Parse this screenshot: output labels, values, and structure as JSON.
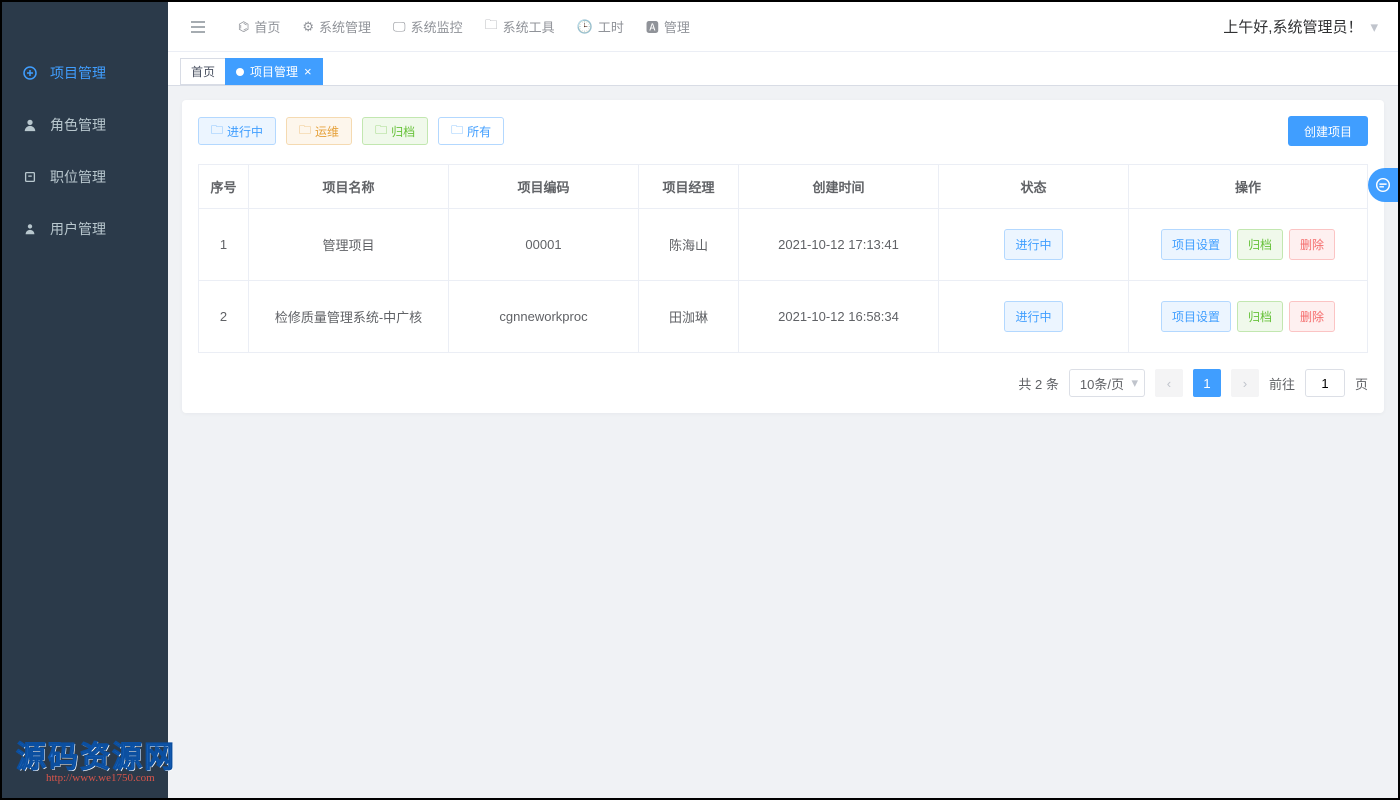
{
  "sidebar": {
    "items": [
      {
        "label": "项目管理",
        "icon": "plus-circle-icon",
        "active": true
      },
      {
        "label": "角色管理",
        "icon": "user-icon",
        "active": false
      },
      {
        "label": "职位管理",
        "icon": "badge-icon",
        "active": false
      },
      {
        "label": "用户管理",
        "icon": "person-icon",
        "active": false
      }
    ]
  },
  "topnav": {
    "items": [
      {
        "label": "首页",
        "icon": "dashboard-icon"
      },
      {
        "label": "系统管理",
        "icon": "gear-icon"
      },
      {
        "label": "系统监控",
        "icon": "monitor-icon"
      },
      {
        "label": "系统工具",
        "icon": "toolbox-icon"
      },
      {
        "label": "工时",
        "icon": "clock-icon"
      },
      {
        "label": "管理",
        "icon": "user-sq-icon"
      }
    ],
    "greeting": "上午好,系统管理员！"
  },
  "tabs": {
    "home": "首页",
    "active_tab": "项目管理"
  },
  "filters": {
    "in_progress": "进行中",
    "ops": "运维",
    "archived": "归档",
    "all": "所有"
  },
  "create_button": "创建项目",
  "table": {
    "headers": {
      "seq": "序号",
      "name": "项目名称",
      "code": "项目编码",
      "manager": "项目经理",
      "created": "创建时间",
      "status": "状态",
      "actions": "操作"
    },
    "rows": [
      {
        "seq": "1",
        "name": "管理项目",
        "code": "00001",
        "manager": "陈海山",
        "created": "2021-10-12 17:13:41",
        "status": "进行中"
      },
      {
        "seq": "2",
        "name": "检修质量管理系统-中广核",
        "code": "cgnneworkproc",
        "manager": "田泇琳",
        "created": "2021-10-12 16:58:34",
        "status": "进行中"
      }
    ],
    "action_labels": {
      "settings": "项目设置",
      "archive": "归档",
      "delete": "删除"
    }
  },
  "pagination": {
    "total_text": "共 2 条",
    "page_size": "10条/页",
    "current_page": "1",
    "goto_label": "前往",
    "goto_value": "1",
    "page_suffix": "页"
  },
  "watermark": {
    "main": "源码资源网",
    "sub": "http://www.we1750.com"
  }
}
